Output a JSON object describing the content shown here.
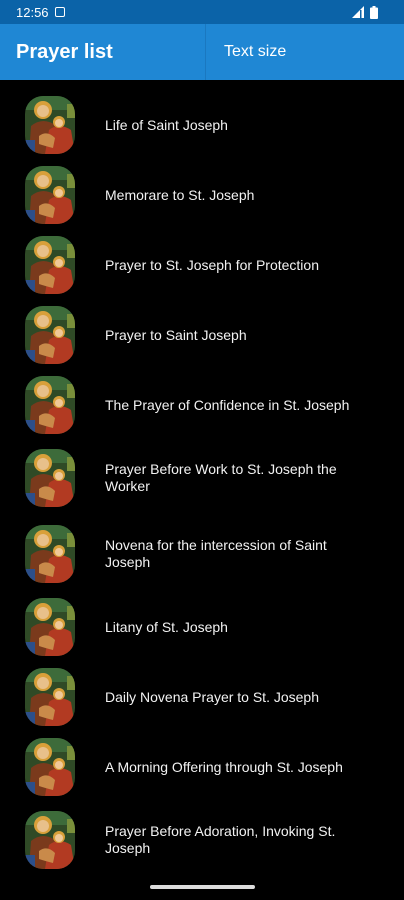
{
  "status_bar": {
    "time": "12:56",
    "icons": [
      "notification-icon",
      "signal-icon",
      "battery-icon"
    ]
  },
  "app_bar": {
    "title": "Prayer list",
    "text_size_label": "Text size",
    "color": "#1f87d4"
  },
  "prayers": [
    {
      "label": "Life of Saint Joseph"
    },
    {
      "label": "Memorare to St. Joseph"
    },
    {
      "label": "Prayer to St. Joseph for Protection"
    },
    {
      "label": "Prayer to Saint Joseph"
    },
    {
      "label": "The Prayer of Confidence in St. Joseph"
    },
    {
      "label": "Prayer Before Work to St. Joseph the Worker"
    },
    {
      "label": "Novena for the intercession of Saint Joseph"
    },
    {
      "label": "Litany of St. Joseph"
    },
    {
      "label": "Daily Novena Prayer to St. Joseph"
    },
    {
      "label": "A Morning Offering through St. Joseph"
    },
    {
      "label": "Prayer Before Adoration, Invoking St. Joseph"
    }
  ],
  "thumbnail_icon": "saint-joseph-stained-glass-icon"
}
